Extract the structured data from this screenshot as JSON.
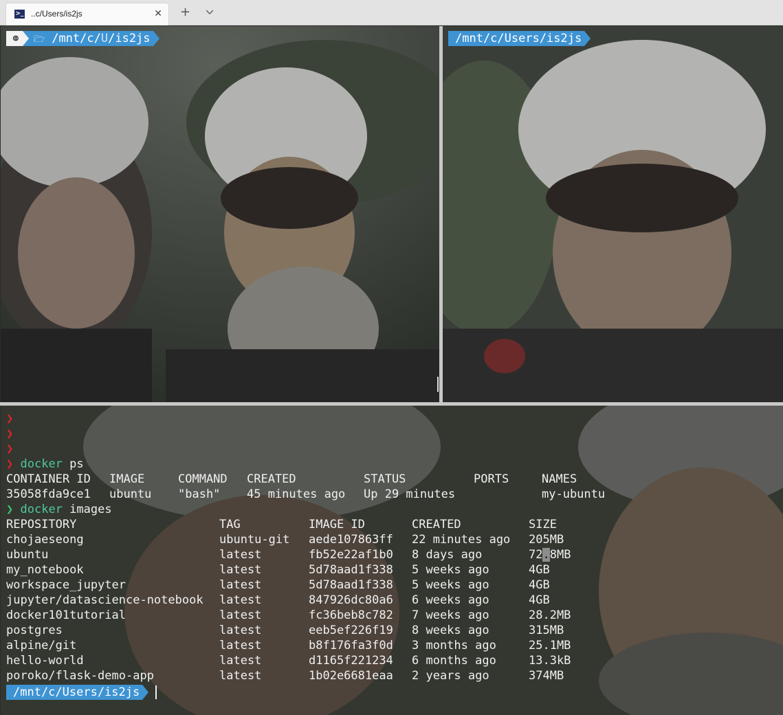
{
  "window": {
    "tab_title": "..c/Users/is2js",
    "tab_icon": "powershell-icon",
    "close_glyph": "✕",
    "new_tab_glyph": "+",
    "dropdown_icon": "chevron-down-icon"
  },
  "colors": {
    "prompt_path_bg": "#3e93d3",
    "prompt_os_bg": "#f2f2f2",
    "chevron_red": "#e0232b",
    "chevron_green": "#3cc070",
    "command_text": "#4fc7a0",
    "terminal_text": "#f0f0f0"
  },
  "pane_top_left": {
    "os_icon": "ubuntu-icon",
    "folder_icon": "folder-open-icon",
    "path_prefix": "/mnt/c/",
    "path_highlight": "U",
    "path_suffix": "/is2js"
  },
  "pane_top_right": {
    "path": "/mnt/c/Users/is2js"
  },
  "pane_bottom": {
    "chevron": "❯",
    "cmd1": {
      "cmd": "docker",
      "args": "ps"
    },
    "ps_headers": [
      "CONTAINER ID",
      "IMAGE",
      "COMMAND",
      "CREATED",
      "STATUS",
      "PORTS",
      "NAMES"
    ],
    "ps_rows": [
      [
        "35058fda9ce1",
        "ubuntu",
        "\"bash\"",
        "45 minutes ago",
        "Up 29 minutes",
        "",
        "my-ubuntu"
      ]
    ],
    "cmd2": {
      "cmd": "docker",
      "args": "images"
    },
    "img_headers": [
      "REPOSITORY",
      "TAG",
      "IMAGE ID",
      "CREATED",
      "SIZE"
    ],
    "img_rows": [
      [
        "chojaeseong",
        "ubuntu-git",
        "aede107863ff",
        "22 minutes ago",
        "205MB"
      ],
      [
        "ubuntu",
        "latest",
        "fb52e22af1b0",
        "8 days ago",
        "72.8MB"
      ],
      [
        "my_notebook",
        "latest",
        "5d78aad1f338",
        "5 weeks ago",
        "4GB"
      ],
      [
        "workspace_jupyter",
        "latest",
        "5d78aad1f338",
        "5 weeks ago",
        "4GB"
      ],
      [
        "jupyter/datascience-notebook",
        "latest",
        "847926dc80a6",
        "6 weeks ago",
        "4GB"
      ],
      [
        "docker101tutorial",
        "latest",
        "fc36beb8c782",
        "7 weeks ago",
        "28.2MB"
      ],
      [
        "postgres",
        "latest",
        "eeb5ef226f19",
        "8 weeks ago",
        "315MB"
      ],
      [
        "alpine/git",
        "latest",
        "b8f176fa3f0d",
        "3 months ago",
        "25.1MB"
      ],
      [
        "hello-world",
        "latest",
        "d1165f221234",
        "6 months ago",
        "13.3kB"
      ],
      [
        "poroko/flask-demo-app",
        "latest",
        "1b02e6681eaa",
        "2 years ago",
        "374MB"
      ]
    ],
    "prompt_path": "/mnt/c/Users/is2js"
  }
}
